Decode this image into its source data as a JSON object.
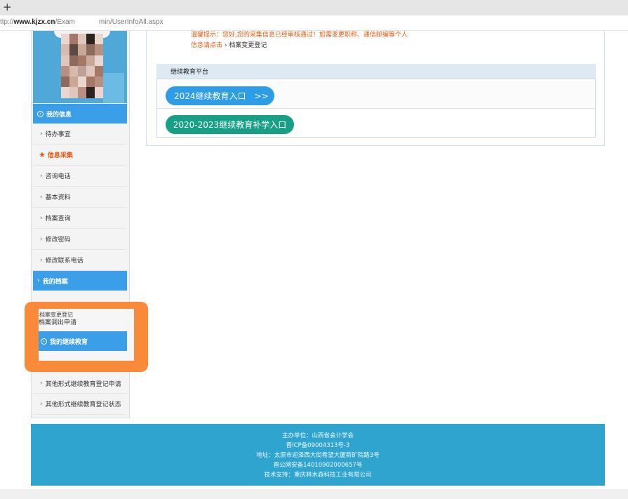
{
  "browser": {
    "new_tab": "+",
    "url_prefix": "ttp://",
    "url_domain": "www.kjzx.cn",
    "url_path_start": "/Exam",
    "url_path_end": "min/UserInfoAll.aspx"
  },
  "sidebar": {
    "my_info": "我的信息",
    "todo": "待办事宜",
    "info_collect": "信息采集",
    "items": [
      "咨询电话",
      "基本资料",
      "档案查询",
      "修改密码",
      "修改联系电话"
    ],
    "my_archive": "我的档案",
    "archive_change": "档案变更登记",
    "archive_transfer": "档案调出申请",
    "my_edu": "我的继续教育",
    "other_edu_apply": "其他形式继续教育登记申请",
    "other_edu_status": "其他形式继续教育登记状态"
  },
  "notice": {
    "line1": "温馨提示：您好,您的采集信息已经审核通过！如需变更职称、通信邮编等个人",
    "line2_prefix": "信息请点击",
    "line2_link": "档案变更登记"
  },
  "platform": {
    "title": "继续教育平台",
    "btn_2024": "2024继续教育入口　>>",
    "btn_2020": "2020-2023继续教育补学入口"
  },
  "footer": {
    "host": "主办单位：山西省会计学会",
    "icp": "晋ICP备09004313号-3",
    "address": "地址：太原市迎泽西大街希望大厦新矿院路3号",
    "police": "晋公网安备14010902000657号",
    "support": "技术支持：重庆林木森科技工业有限公司"
  },
  "colors": {
    "nav_blue": "#3a9ee8",
    "orange_highlight": "#f98a3a",
    "btn_2024": "#2e9de8",
    "btn_2020": "#17a086",
    "footer": "#2ea4cf",
    "notice": "#e85a0c"
  }
}
